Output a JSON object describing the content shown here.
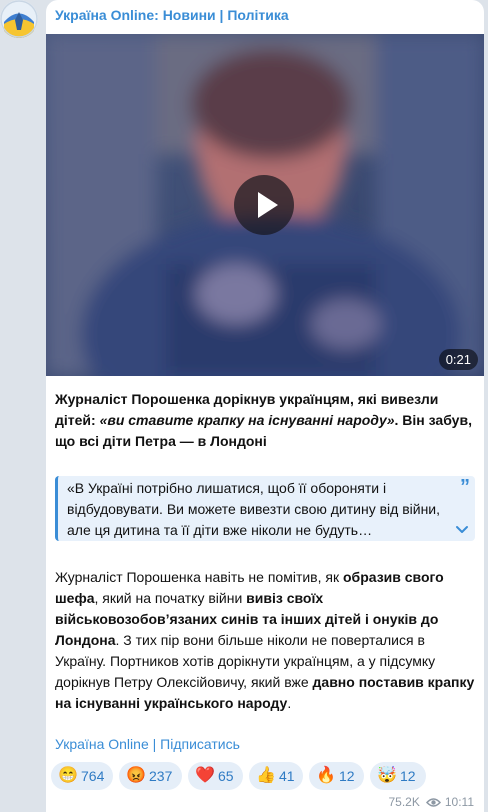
{
  "channel": {
    "title": "Україна Online: Новини | Політика"
  },
  "video": {
    "duration": "0:21"
  },
  "post": {
    "headline_part1": "Журналіст Порошенка дорікнув українцям, які вивезли дітей: ",
    "headline_part2": "«ви ставите крапку на існуванні народу»",
    "headline_part3": ". Він забув, що всі діти Петра — в Лондоні",
    "quote_text": "«В Україні потрібно лишатися, щоб її обороняти і відбудовувати. Ви можете вивезти свою дитину від війни, але ця дитина та її діти вже ніколи не будуть…",
    "body": [
      {
        "t": "Журналіст Порошенка навіть не помітив, як ",
        "b": false
      },
      {
        "t": "образив свого шефа",
        "b": true
      },
      {
        "t": ", який на початку війни ",
        "b": false
      },
      {
        "t": "вивіз своїх військовозобов’язаних синів та інших дітей і онуків до Лондона",
        "b": true
      },
      {
        "t": ". З тих пір вони більше ніколи не поверталися в Україну. Портников хотів дорікнути українцям, а у підсумку дорікнув Петру Олексійовичу, який вже ",
        "b": false
      },
      {
        "t": "давно поставив крапку на існуванні українського народу",
        "b": true
      },
      {
        "t": ".",
        "b": false
      }
    ],
    "link_channel": "Україна Online",
    "link_separator": "|",
    "link_subscribe": "Підписатись"
  },
  "reactions": [
    {
      "emoji": "😁",
      "count": "764"
    },
    {
      "emoji": "😡",
      "count": "237"
    },
    {
      "emoji": "❤️",
      "count": "65"
    },
    {
      "emoji": "👍",
      "count": "41"
    },
    {
      "emoji": "🔥",
      "count": "12"
    },
    {
      "emoji": "🤯",
      "count": "12"
    }
  ],
  "meta": {
    "views": "75.2K",
    "time": "10:11"
  },
  "icons": {
    "quote": "quote-icon",
    "expand": "chevron-down-icon",
    "views": "eye-icon",
    "play": "play-icon"
  },
  "colors": {
    "accent": "#3a8dd6",
    "quote_bg": "#e8f1fb",
    "reaction_bg": "#e5eef8"
  }
}
